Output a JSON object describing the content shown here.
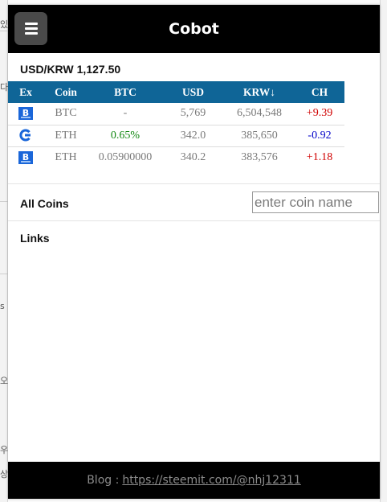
{
  "app": {
    "title": "Cobot"
  },
  "rate": {
    "pair": "USD/KRW",
    "value": "1,127.50"
  },
  "table": {
    "headers": [
      "Ex",
      "Coin",
      "BTC",
      "USD",
      "KRW↓",
      "CH"
    ],
    "rows": [
      {
        "exchange_icon": "b-exchange-icon",
        "coin": "BTC",
        "btc": "-",
        "usd": "5,769",
        "krw": "6,504,548",
        "ch": "+9.39",
        "ch_color": "#d00000"
      },
      {
        "exchange_icon": "c-exchange-icon",
        "coin": "ETH",
        "btc": "0.65%",
        "usd": "342.0",
        "krw": "385,650",
        "ch": "-0.92",
        "ch_color": "#0000c8"
      },
      {
        "exchange_icon": "b-exchange-icon",
        "coin": "ETH",
        "btc": "0.05900000",
        "usd": "340.2",
        "krw": "383,576",
        "ch": "+1.18",
        "ch_color": "#d00000"
      }
    ]
  },
  "all_coins": {
    "label": "All Coins",
    "placeholder": "enter coin name"
  },
  "links": {
    "label": "Links"
  },
  "footer": {
    "prefix": "Blog :",
    "link": "https://steemit.com/@nhj12311"
  },
  "colors": {
    "header_bg": "#000000",
    "table_header": "#0f6597",
    "positive": "#d00000",
    "negative": "#0000c8",
    "btc_green": "#118811"
  },
  "background_glyphs": [
    "있",
    "다",
    "s",
    "오",
    "우",
    "상"
  ]
}
